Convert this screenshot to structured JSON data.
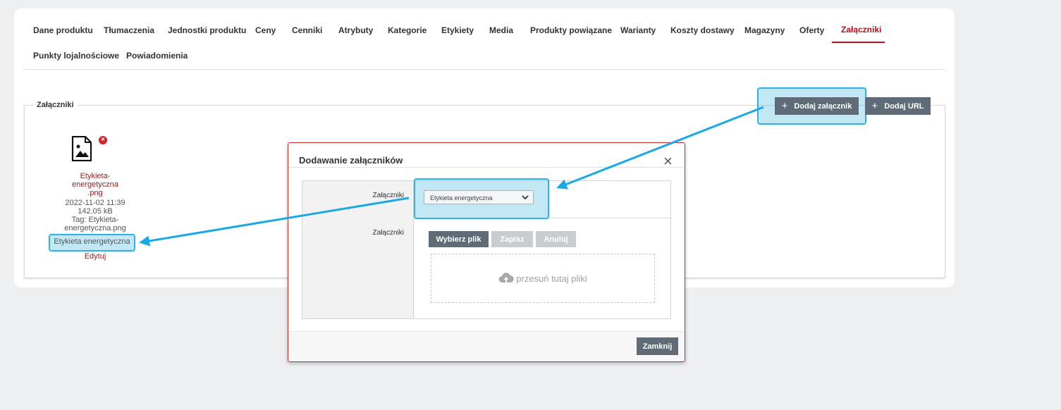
{
  "tabs": [
    {
      "label": "Dane produktu"
    },
    {
      "label": "Tłumaczenia"
    },
    {
      "label": "Jednostki produktu"
    },
    {
      "label": "Ceny"
    },
    {
      "label": "Cenniki"
    },
    {
      "label": "Atrybuty"
    },
    {
      "label": "Kategorie"
    },
    {
      "label": "Etykiety"
    },
    {
      "label": "Media"
    },
    {
      "label": "Produkty powiązane"
    },
    {
      "label": "Warianty"
    },
    {
      "label": "Koszty dostawy"
    },
    {
      "label": "Magazyny"
    },
    {
      "label": "Oferty"
    },
    {
      "label": "Załączniki"
    },
    {
      "label": "Punkty lojalnościowe"
    },
    {
      "label": "Powiadomienia"
    }
  ],
  "active_tab": "Załączniki",
  "attachments_section": {
    "legend": "Załączniki",
    "add_attachment_label": "Dodaj załącznik",
    "add_url_label": "Dodaj URL"
  },
  "attachment": {
    "name_line1": "Etykieta-",
    "name_line2": "energetyczna",
    "name_line3": ".png",
    "date": "2022-11-02 11:39",
    "size": "142.05 kB",
    "tag_line1": "Tag: Etykieta-",
    "tag_line2": "energetyczna.png",
    "label": "Etykieta energetyczna",
    "edit_label": "Edytuj"
  },
  "modal": {
    "title": "Dodawanie załączników",
    "row1_label": "Załączniki",
    "select_value": "Etykieta energetyczna",
    "row2_label": "Załączniki",
    "choose_file_label": "Wybierz plik",
    "save_label": "Zapisz",
    "cancel_label": "Anuluj",
    "drop_text": "przesuń tutaj pliki",
    "close_label": "Zamknij"
  },
  "colors": {
    "accent": "#b5121b",
    "dark_button": "#5f6b76",
    "highlight": "#2fb2e8"
  }
}
